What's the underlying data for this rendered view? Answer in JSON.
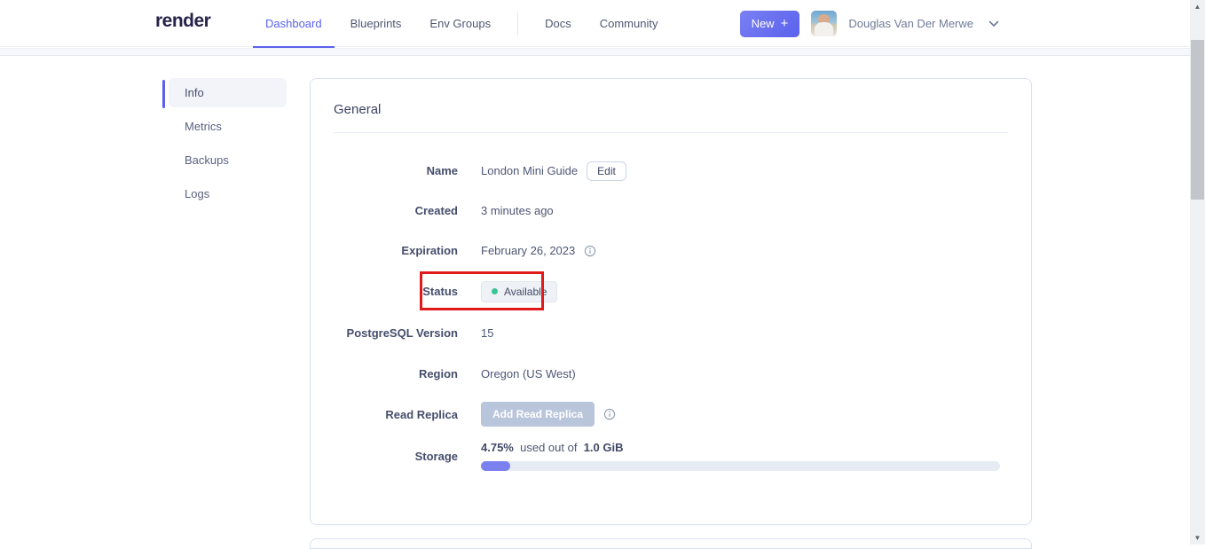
{
  "header": {
    "logo": "render",
    "nav": [
      {
        "label": "Dashboard",
        "active": true
      },
      {
        "label": "Blueprints",
        "active": false
      },
      {
        "label": "Env Groups",
        "active": false
      },
      {
        "label": "Docs",
        "active": false
      },
      {
        "label": "Community",
        "active": false
      }
    ],
    "new_button_label": "New",
    "new_button_plus": "+",
    "user_name": "Douglas Van Der Merwe"
  },
  "sidebar": {
    "items": [
      {
        "label": "Info",
        "active": true
      },
      {
        "label": "Metrics",
        "active": false
      },
      {
        "label": "Backups",
        "active": false
      },
      {
        "label": "Logs",
        "active": false
      }
    ]
  },
  "card": {
    "title": "General",
    "name_label": "Name",
    "name_value": "London Mini Guide",
    "edit_button": "Edit",
    "created_label": "Created",
    "created_value": "3 minutes ago",
    "expiration_label": "Expiration",
    "expiration_value": "February 26, 2023",
    "status_label": "Status",
    "status_value": "Available",
    "postgres_label": "PostgreSQL Version",
    "postgres_value": "15",
    "region_label": "Region",
    "region_value": "Oregon (US West)",
    "replica_label": "Read Replica",
    "replica_button": "Add Read Replica",
    "storage_label": "Storage",
    "storage_used_pct": "4.75%",
    "storage_mid_text": "used out of",
    "storage_total": "1.0 GiB",
    "storage_fill_percent": 4.75
  },
  "colors": {
    "accent": "#5a61ed",
    "status_dot_green": "#36c593",
    "annotation_red": "#e01a1a",
    "progress_fill": "#7b82f0",
    "disabled_button": "#b9c5da"
  }
}
